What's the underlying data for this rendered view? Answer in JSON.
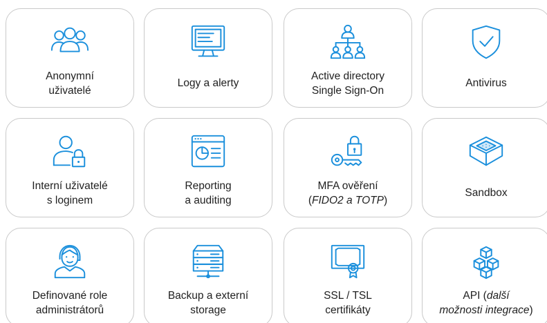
{
  "cards": [
    {
      "label_1": "Anonymní",
      "label_2": "uživatelé",
      "icon": "users-group-icon"
    },
    {
      "label_1": "Logy a alerty",
      "icon": "monitor-log-icon"
    },
    {
      "label_1": "Active directory",
      "label_2": "Single Sign-On",
      "icon": "org-hierarchy-icon"
    },
    {
      "label_1": "Antivirus",
      "icon": "shield-check-icon"
    },
    {
      "label_1": "Interní uživatelé",
      "label_2": "s loginem",
      "icon": "user-lock-icon"
    },
    {
      "label_1": "Reporting",
      "label_2": "a auditing",
      "icon": "report-window-icon"
    },
    {
      "label_1": "MFA ověření",
      "label_2_open": "(",
      "label_2_italic": "FIDO2 a TOTP",
      "label_2_close": ")",
      "icon": "key-lock-icon"
    },
    {
      "label_1": "Sandbox",
      "icon": "sandbox-box-icon"
    },
    {
      "label_1": "Definované role",
      "label_2": "administrátorů",
      "icon": "support-agent-icon"
    },
    {
      "label_1": "Backup a externí",
      "label_2": "storage",
      "icon": "server-storage-icon"
    },
    {
      "label_1": "SSL / TSL",
      "label_2": "certifikáty",
      "icon": "certificate-icon"
    },
    {
      "label_1_plain": "API (",
      "label_1_italic": "další",
      "label_2_italic": "možnosti integrace",
      "label_2_close": ")",
      "icon": "cubes-api-icon"
    }
  ]
}
